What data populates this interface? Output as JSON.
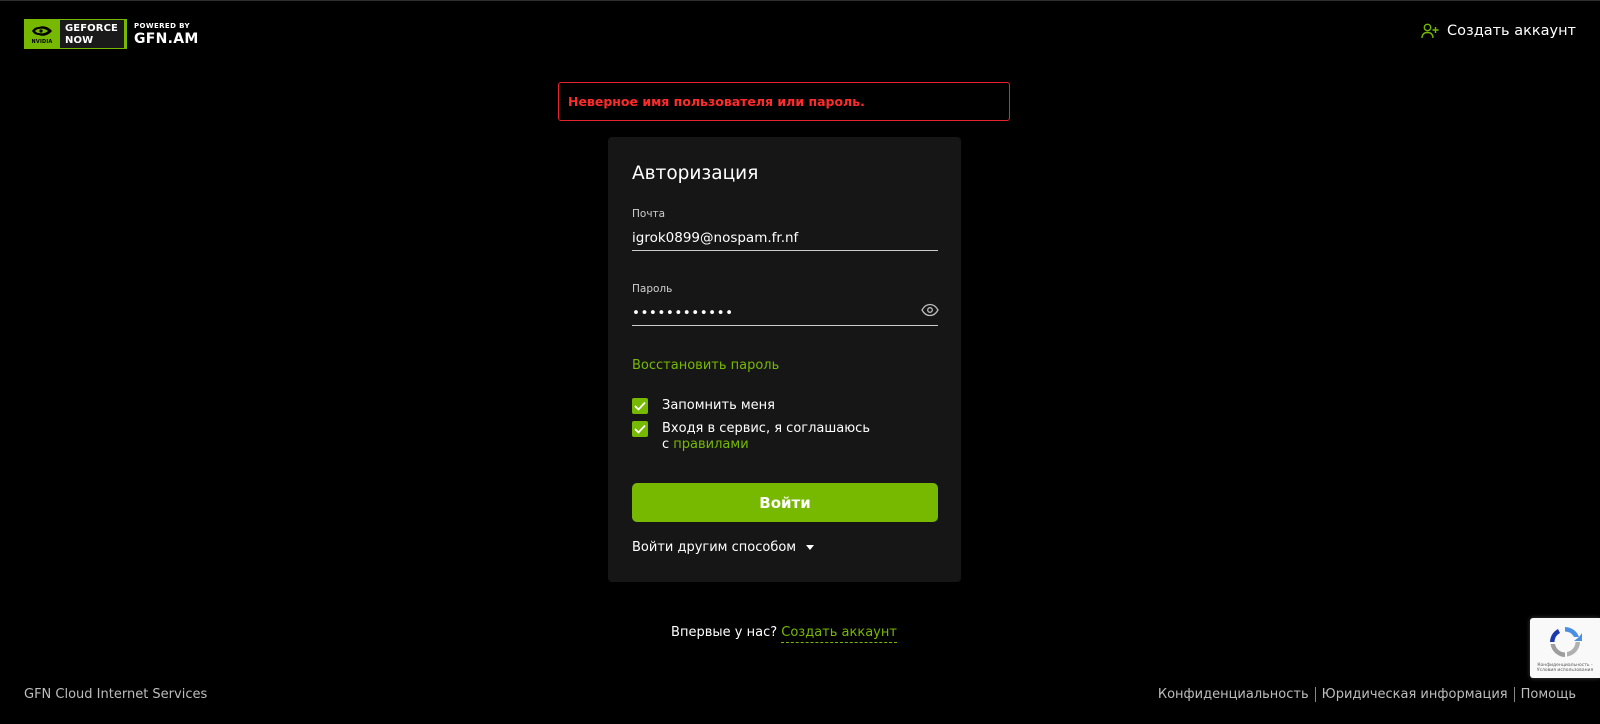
{
  "header": {
    "logo": {
      "nvidia_text": "NVIDIA",
      "geforce_line1": "GEFORCE",
      "geforce_line2": "NOW",
      "powered_by": "POWERED BY",
      "brand": "GFN.AM"
    },
    "create_account": "Создать аккаунт",
    "create_account_icon": "user-plus-icon"
  },
  "error": {
    "message": "Неверное имя пользователя или пароль.",
    "color": "#e8232e"
  },
  "login": {
    "title": "Авторизация",
    "email_label": "Почта",
    "email_value": "igrok0899@nospam.fr.nf",
    "password_label": "Пароль",
    "password_value": "••••••••••••",
    "forgot_password": "Восстановить пароль",
    "remember_me": "Запомнить меня",
    "remember_checked": true,
    "agree_text": "Входя в сервис, я соглашаюсь",
    "agree_prefix": "с",
    "agree_link": "правилами",
    "agree_checked": true,
    "submit": "Войти",
    "other_method": "Войти другим способом"
  },
  "signup_prompt": {
    "text": "Впервые у нас?",
    "link": "Создать аккаунт"
  },
  "footer": {
    "company": "GFN Cloud Internet Services",
    "links": [
      "Конфиденциальность",
      "Юридическая информация",
      "Помощь"
    ]
  },
  "recaptcha": {
    "text": "Конфиденциальность - Условия использования"
  },
  "colors": {
    "accent": "#76b900",
    "background": "#000000",
    "card": "#161616",
    "error": "#ff2a2a"
  }
}
